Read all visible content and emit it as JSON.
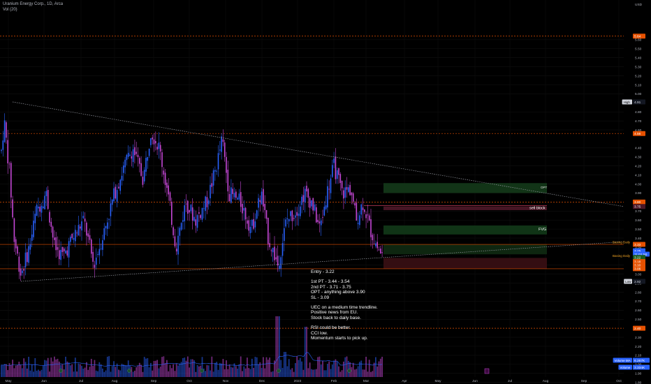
{
  "header": {
    "symbol_line": "Uranium Energy Corp., 1D, Arca",
    "vol_line": "Vol (20)"
  },
  "annotations": {
    "entry": "Entry - 3.22",
    "pt1": "1st PT - 3.44 - 3.54",
    "pt2": "2nd PT - 3.71 - 3.75",
    "opt": "OPT - anything above 3.90",
    "sl": "SL - 3.09",
    "c1": "UEC on a medium time trendline.",
    "c2": "Positive news from EU.",
    "c3": "Stock back to daily base.",
    "c4": "RSI could be better.",
    "c5": "CCI low.",
    "c6": "Momentum starts to pick up.",
    "zone_opt": "OPT",
    "zone_sell_block": "sell block",
    "zone_fvg": "FVG",
    "basing_daily_upper": "Basing Daily",
    "basing_daily_lower": "Basing Daily"
  },
  "colors": {
    "up": "#2962ff",
    "down": "#c547d6",
    "level_line": "#e65100",
    "trendline": "#9598a1",
    "zone_green": "#1b5e20",
    "zone_red": "#7f1d2e",
    "price_tag": "#2962ff"
  },
  "chart_data": {
    "type": "candlestick",
    "symbol": "Uranium Energy Corp.",
    "interval": "1D",
    "exchange": "Arca",
    "currency": "USD",
    "y_axis_labels": [
      "USD",
      "5.60",
      "5.50",
      "5.40",
      "5.30",
      "5.20",
      "5.10",
      "5.00",
      "4.80",
      "4.70",
      "4.60",
      "4.40",
      "4.30",
      "4.20",
      "4.10",
      "4.00",
      "3.90",
      "3.70",
      "3.60",
      "3.50",
      "3.40",
      "3.30",
      "3.10",
      "3.00",
      "2.90",
      "2.80",
      "2.70",
      "2.60",
      "2.50",
      "2.30",
      "2.20",
      "2.10",
      "2.00",
      "1.90",
      "1.80"
    ],
    "ylim": [
      1.8,
      5.7
    ],
    "x_axis_labels": [
      "May",
      "Jun",
      "Jul",
      "Aug",
      "Sep",
      "Oct",
      "Nov",
      "Dec",
      "2023",
      "Feb",
      "Mar",
      "Apr",
      "May",
      "Jun",
      "Jul",
      "Aug",
      "Sep",
      "Oct"
    ],
    "levels": [
      5.64,
      4.56,
      3.8,
      3.33,
      3.06,
      2.4
    ],
    "price_tags": [
      {
        "label": "High",
        "value": "4.91"
      },
      {
        "label": "",
        "value": "5.64"
      },
      {
        "label": "",
        "value": "4.56"
      },
      {
        "label": "",
        "value": "3.80"
      },
      {
        "label": "",
        "value": "3.75"
      },
      {
        "label": "",
        "value": "3.33"
      },
      {
        "label": "",
        "value": "3.25"
      },
      {
        "label": "",
        "value": "11:01:50"
      },
      {
        "label": "",
        "value": "3.22"
      },
      {
        "label": "",
        "value": "3.18"
      },
      {
        "label": "",
        "value": "3.10"
      },
      {
        "label": "",
        "value": "3.06"
      },
      {
        "label": "Low",
        "value": "2.92"
      },
      {
        "label": "",
        "value": "2.40"
      },
      {
        "label": "Volume MA",
        "value": "6.267K"
      },
      {
        "label": "Volume",
        "value": "3.334K"
      }
    ],
    "zones": [
      {
        "name": "OPT",
        "low": 3.9,
        "high": 4.01
      },
      {
        "name": "sell block",
        "low": 3.71,
        "high": 3.75
      },
      {
        "name": "FVG",
        "low": 3.44,
        "high": 3.54
      },
      {
        "name": "",
        "low": 3.22,
        "high": 3.33
      },
      {
        "name": "",
        "low": 3.06,
        "high": 3.18
      }
    ],
    "trendlines": [
      {
        "from": [
          "May",
          4.91
        ],
        "to": [
          "Oct",
          3.75
        ]
      },
      {
        "from": [
          "May",
          2.92
        ],
        "to": [
          "Oct",
          3.4
        ]
      }
    ],
    "volume_spike_months": [
      "Dec",
      "Feb"
    ],
    "series_note": "daily OHLC candles May 2022 – Mar 2023 ranging ~2.9 to ~4.9; volume histogram with 20-period MA"
  }
}
